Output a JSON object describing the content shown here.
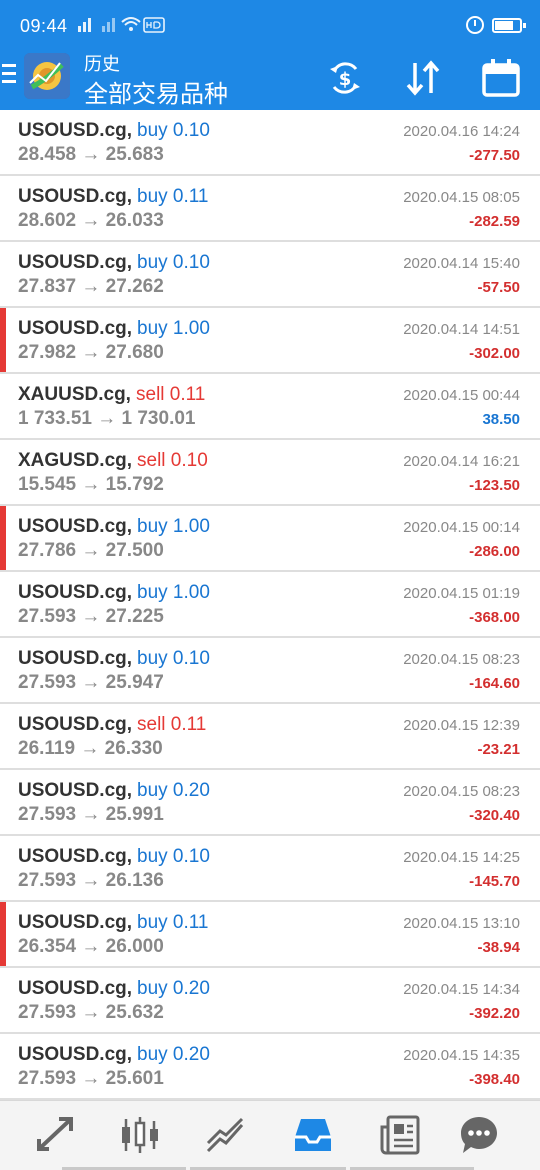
{
  "status": {
    "time": "09:44"
  },
  "header": {
    "subtitle": "历史",
    "title": "全部交易品种"
  },
  "colors": {
    "brand": "#1e88e5",
    "buy": "#1976d2",
    "sell": "#e53935",
    "loss": "#d32f2f",
    "gain": "#1976d2"
  },
  "toolbar": {
    "icons": [
      "currency-exchange-icon",
      "sort-icon",
      "calendar-icon"
    ]
  },
  "trades": [
    {
      "symbol": "USOUSD.cg,",
      "direction": "buy 0.10",
      "side": "buy",
      "prices": "28.458 → 25.683",
      "date": "2020.04.16 14:24",
      "profit": "-277.50",
      "marked": false
    },
    {
      "symbol": "USOUSD.cg,",
      "direction": "buy 0.11",
      "side": "buy",
      "prices": "28.602 → 26.033",
      "date": "2020.04.15 08:05",
      "profit": "-282.59",
      "marked": false
    },
    {
      "symbol": "USOUSD.cg,",
      "direction": "buy 0.10",
      "side": "buy",
      "prices": "27.837 → 27.262",
      "date": "2020.04.14 15:40",
      "profit": "-57.50",
      "marked": false
    },
    {
      "symbol": "USOUSD.cg,",
      "direction": "buy 1.00",
      "side": "buy",
      "prices": "27.982 → 27.680",
      "date": "2020.04.14 14:51",
      "profit": "-302.00",
      "marked": true
    },
    {
      "symbol": "XAUUSD.cg,",
      "direction": "sell 0.11",
      "side": "sell",
      "prices": "1 733.51 → 1 730.01",
      "date": "2020.04.15 00:44",
      "profit": "38.50",
      "marked": false
    },
    {
      "symbol": "XAGUSD.cg,",
      "direction": "sell 0.10",
      "side": "sell",
      "prices": "15.545 → 15.792",
      "date": "2020.04.14 16:21",
      "profit": "-123.50",
      "marked": false
    },
    {
      "symbol": "USOUSD.cg,",
      "direction": "buy 1.00",
      "side": "buy",
      "prices": "27.786 → 27.500",
      "date": "2020.04.15 00:14",
      "profit": "-286.00",
      "marked": true
    },
    {
      "symbol": "USOUSD.cg,",
      "direction": "buy 1.00",
      "side": "buy",
      "prices": "27.593 → 27.225",
      "date": "2020.04.15 01:19",
      "profit": "-368.00",
      "marked": false
    },
    {
      "symbol": "USOUSD.cg,",
      "direction": "buy 0.10",
      "side": "buy",
      "prices": "27.593 → 25.947",
      "date": "2020.04.15 08:23",
      "profit": "-164.60",
      "marked": false
    },
    {
      "symbol": "USOUSD.cg,",
      "direction": "sell 0.11",
      "side": "sell",
      "prices": "26.119 → 26.330",
      "date": "2020.04.15 12:39",
      "profit": "-23.21",
      "marked": false
    },
    {
      "symbol": "USOUSD.cg,",
      "direction": "buy 0.20",
      "side": "buy",
      "prices": "27.593 → 25.991",
      "date": "2020.04.15 08:23",
      "profit": "-320.40",
      "marked": false
    },
    {
      "symbol": "USOUSD.cg,",
      "direction": "buy 0.10",
      "side": "buy",
      "prices": "27.593 → 26.136",
      "date": "2020.04.15 14:25",
      "profit": "-145.70",
      "marked": false
    },
    {
      "symbol": "USOUSD.cg,",
      "direction": "buy 0.11",
      "side": "buy",
      "prices": "26.354 → 26.000",
      "date": "2020.04.15 13:10",
      "profit": "-38.94",
      "marked": true
    },
    {
      "symbol": "USOUSD.cg,",
      "direction": "buy 0.20",
      "side": "buy",
      "prices": "27.593 → 25.632",
      "date": "2020.04.15 14:34",
      "profit": "-392.20",
      "marked": false
    },
    {
      "symbol": "USOUSD.cg,",
      "direction": "buy 0.20",
      "side": "buy",
      "prices": "27.593 → 25.601",
      "date": "2020.04.15 14:35",
      "profit": "-398.40",
      "marked": false
    }
  ],
  "bottom_nav": [
    "quotes-icon",
    "chart-icon",
    "trade-icon",
    "history-icon",
    "news-icon",
    "chat-icon"
  ]
}
